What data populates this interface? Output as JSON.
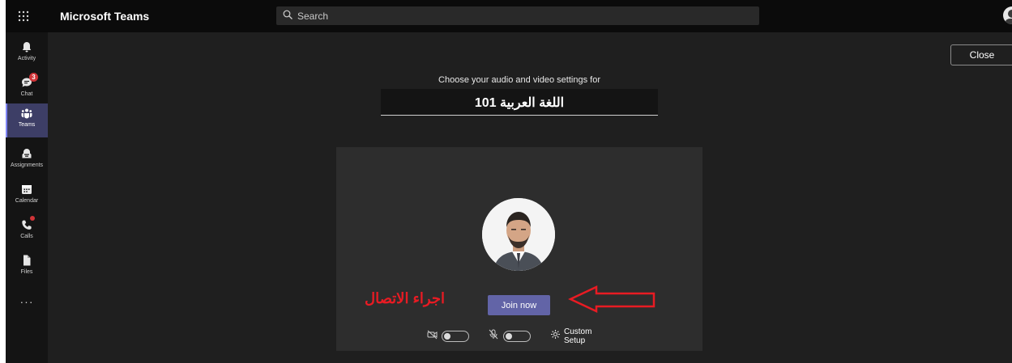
{
  "topbar": {
    "app_title": "Microsoft Teams",
    "search_placeholder": "Search",
    "icons": {
      "launcher": "app-launcher-icon",
      "search": "search-icon",
      "profile": "avatar"
    }
  },
  "rail": {
    "items": [
      {
        "label": "Activity",
        "icon": "bell-icon"
      },
      {
        "label": "Chat",
        "icon": "chat-icon",
        "badge": "3"
      },
      {
        "label": "Teams",
        "icon": "teams-icon",
        "active": true
      },
      {
        "label": "Assignments",
        "icon": "assignments-icon"
      },
      {
        "label": "Calendar",
        "icon": "calendar-icon"
      },
      {
        "label": "Calls",
        "icon": "phone-icon",
        "has_dot": true
      },
      {
        "label": "Files",
        "icon": "file-icon"
      }
    ],
    "more_label": "···"
  },
  "prejoin": {
    "close_label": "Close",
    "subtitle": "Choose your audio and video settings for",
    "meeting_name": "اللغة العربية 101",
    "join_label": "Join now",
    "annotation": "اجراء الاتصال",
    "custom_setup_label": "Custom Setup",
    "camera_on": false,
    "mic_on": false
  },
  "colors": {
    "accent": "#6264a7",
    "badge": "#d13438",
    "annotation": "#e81b23",
    "background": "#1f1f1f"
  }
}
